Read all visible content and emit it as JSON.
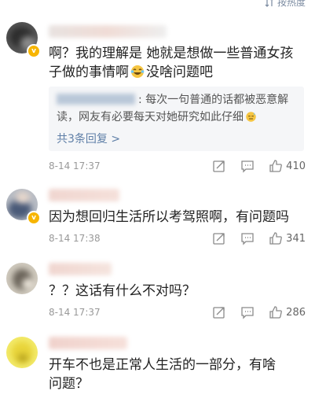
{
  "header": {
    "sort_label": "按热度",
    "sort_icon": "sort-icon"
  },
  "comments": [
    {
      "text_parts": [
        "啊？我的理解是 她就是想做一些普通女孩子做的事情啊",
        "没啥问题吧"
      ],
      "emoji": "laughing-tears-emoji",
      "reply": {
        "text": ": 每次一句普通的话都被恶意解读，网友有必要每天对她研究如此仔细",
        "emoji": "sweat-emoji",
        "more": "共3条回复 >"
      },
      "time": "8-14 17:37",
      "likes": "410"
    },
    {
      "text": "因为想回归生活所以考驾照啊，有问题吗",
      "time": "8-14 17:38",
      "likes": "341"
    },
    {
      "text": "？？这话有什么不对吗？",
      "time": "8-14 17:37",
      "likes": "286"
    },
    {
      "text": "开车不也是正常人生活的一部分，有啥问题？"
    }
  ],
  "colors": {
    "accent": "#5f7fa7",
    "badge": "#f7b500",
    "meta": "#999999"
  }
}
